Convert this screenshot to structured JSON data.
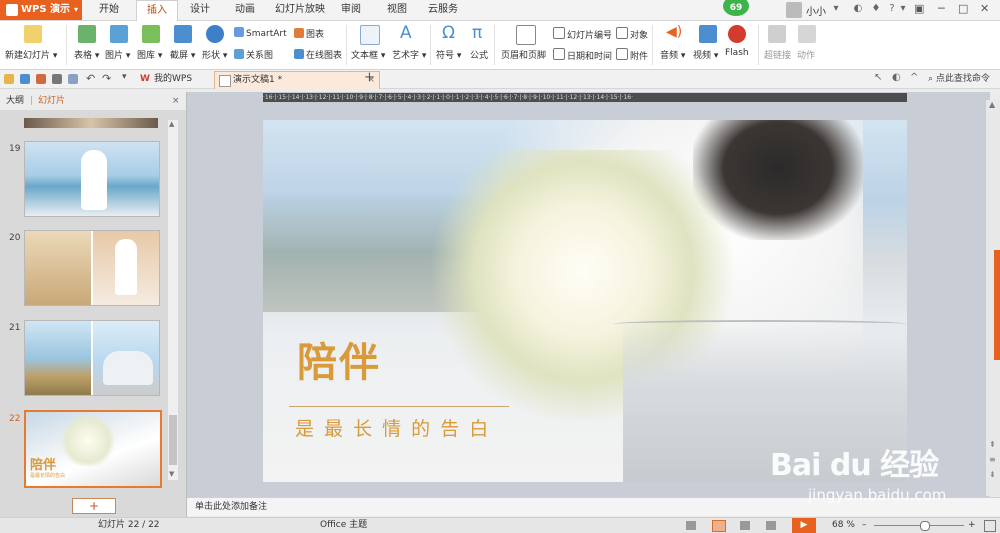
{
  "titlebar": {
    "app_name": "WPS 演示",
    "tabs": [
      {
        "label": "开始"
      },
      {
        "label": "插入"
      },
      {
        "label": "设计"
      },
      {
        "label": "动画"
      },
      {
        "label": "幻灯片放映"
      },
      {
        "label": "审阅"
      },
      {
        "label": "视图"
      },
      {
        "label": "云服务"
      }
    ],
    "active_tab": "插入",
    "badge": "69",
    "user": "小小",
    "help": "?"
  },
  "ribbon": {
    "new_slide": "新建幻灯片",
    "table": "表格",
    "picture": "图片",
    "gallery": "图库",
    "screenshot": "截屏",
    "shape": "形状",
    "smartart": "SmartArt",
    "chart": "图表",
    "relation": "关系图",
    "online_chart": "在线图表",
    "textbox": "文本框",
    "wordart": "艺术字",
    "symbol": "符号",
    "formula": "公式",
    "header_footer": "页眉和页脚",
    "slide_number": "幻灯片编号",
    "date_time": "日期和时间",
    "object": "对象",
    "attachment": "附件",
    "audio": "音频",
    "video": "视频",
    "flash": "Flash",
    "hyperlink": "超链接",
    "action": "动作"
  },
  "quickbar": {
    "tabs": [
      {
        "label": "我的WPS",
        "close": "×"
      },
      {
        "label": "演示文稿1 *",
        "close": "×"
      }
    ],
    "add": "+",
    "search": "点此查找命令"
  },
  "leftpanel": {
    "outline": "大纲",
    "slides": "幻灯片",
    "close": "×",
    "thumbs": [
      {
        "num": "19"
      },
      {
        "num": "20"
      },
      {
        "num": "21"
      },
      {
        "num": "22",
        "title": "陪伴",
        "subtitle": "是最长情的告白"
      }
    ],
    "add": "+"
  },
  "ruler_text": "·16·|·15·|·14·|·13·|·12·|·11·|·10·|·9·|·8·|·7·|·6·|·5·|·4·|·3·|·2·|·1·|·0·|·1·|·2·|·3·|·4·|·5·|·6·|·7·|·8·|·9·|·10·|·11·|·12·|·13·|·14·|·15·|·16·",
  "slide": {
    "title": "陪伴",
    "subtitle": "是 最 长 情 的 告 白",
    "title_color": "#d99a3c"
  },
  "notes": {
    "placeholder": "单击此处添加备注"
  },
  "status": {
    "slide_pos": "幻灯片 22 / 22",
    "theme": "Office 主题",
    "zoom": "68 %",
    "zoom_fraction": 0.55
  },
  "watermark": {
    "logo": "Bai du 经验",
    "url": "jingyan.baidu.com"
  },
  "colors": {
    "accent": "#e8611e",
    "ribbon_bg": "#ffffff"
  }
}
